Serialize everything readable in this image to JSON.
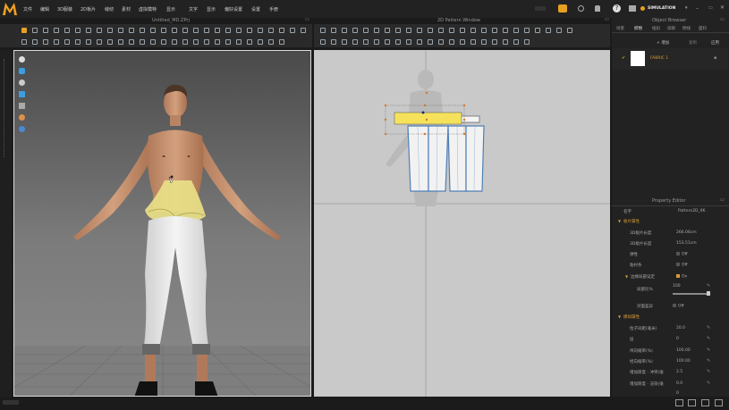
{
  "menu": [
    "文件",
    "编辑",
    "3D服装",
    "2D板片",
    "缝纫",
    "素材",
    "虚拟模特",
    "显示",
    "文字",
    "显示",
    "偏好设置",
    "设置",
    "手册"
  ],
  "mode": {
    "label": "SIMULATION"
  },
  "window_titles": {
    "view3d": "Untitled_MD.ZPrj",
    "view2d": "2D Pattern Window",
    "object_browser": "Object Browser",
    "property_editor": "Property Editor"
  },
  "object_browser": {
    "tabs": [
      "场景",
      "织物",
      "纽扣",
      "扣眼",
      "明线",
      "面料"
    ],
    "add_label": "+ 增加",
    "copy_label": "复制",
    "apply_label": "应用",
    "fabric_name": "FABRIC 1"
  },
  "property_editor": {
    "name_label": "名字",
    "name_value": "Pattern2D_96",
    "sections": {
      "pattern": "板片属性",
      "fabric": "模拟属性"
    },
    "rows": [
      {
        "label": "3D板片长度",
        "value": "266.06cm"
      },
      {
        "label": "3D板片长度",
        "value": "153.51cm"
      },
      {
        "label": "弹性",
        "value": "Off"
      },
      {
        "label": "粘衬条",
        "value": "Off"
      },
      {
        "label": "边缘局部设定",
        "value": "On"
      },
      {
        "label": "局部比%",
        "value": "100"
      },
      {
        "label": "对面差异",
        "value": "Off"
      },
      {
        "label": "粒子间距(毫米)",
        "value": "20.0"
      },
      {
        "label": "层",
        "value": "0"
      },
      {
        "label": "纬向缩率(%)",
        "value": "100.00"
      },
      {
        "label": "经向缩率(%)",
        "value": "100.00"
      },
      {
        "label": "增加厚度 - 冲突(毫",
        "value": "2.5"
      },
      {
        "label": "增加厚度 - 渲染(毫",
        "value": "0.0"
      },
      {
        "label": "",
        "value": "0"
      }
    ]
  },
  "colors": {
    "accent": "#d59b3a",
    "selection": "#f5e25a",
    "pattern_outline": "#4f7fb5"
  }
}
